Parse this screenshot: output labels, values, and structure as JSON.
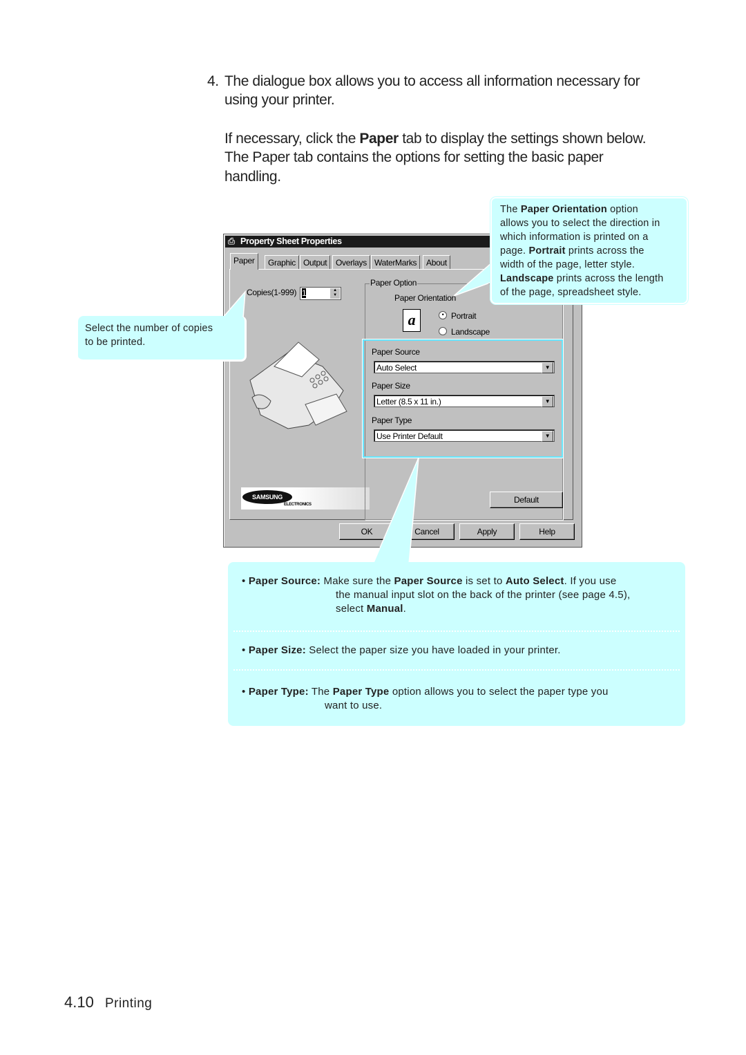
{
  "intro": {
    "step_number": "4.",
    "line1": "The dialogue box allows you to access all information necessary for",
    "line2": "using your printer.",
    "para2_pre": "If necessary, click the ",
    "para2_bold": "Paper",
    "para2_post": " tab to display the settings shown below.",
    "para2_line2": "The Paper tab contains the options for setting the basic paper",
    "para2_line3": "handling."
  },
  "callout_orientation": {
    "t1": "The ",
    "b1": "Paper Orientation",
    "t2": " option",
    "l2": "allows you to select the direction in",
    "l3": "which information is printed on a",
    "t3": "page. ",
    "b2": "Portrait",
    "t4": " prints across the",
    "l5": "width of the page, letter style.",
    "b3": "Landscape",
    "t5": " prints across the length",
    "l7": "of the page, spreadsheet style."
  },
  "callout_copies": {
    "l1": "Select the number of copies",
    "l2": "to be printed."
  },
  "dialog": {
    "title": "Property Sheet Properties",
    "tabs": [
      "Paper",
      "Graphic",
      "Output",
      "Overlays",
      "WaterMarks",
      "About"
    ],
    "copies_label": "Copies(1-999)",
    "copies_value": "1",
    "paper_option_label": "Paper Option",
    "paper_orientation_label": "Paper Orientation",
    "portrait_label": "Portrait",
    "landscape_label": "Landscape",
    "orientation_selected": "Portrait",
    "paper_source_label": "Paper Source",
    "paper_source_value": "Auto Select",
    "paper_size_label": "Paper Size",
    "paper_size_value": "Letter (8.5 x 11 in.)",
    "paper_type_label": "Paper Type",
    "paper_type_value": "Use Printer Default",
    "logo_text": "SAMSUNG",
    "logo_sub": "ELECTRONICS",
    "default_button": "Default",
    "ok_button": "OK",
    "cancel_button": "Cancel",
    "apply_button": "Apply",
    "help_button": "Help"
  },
  "bullets": {
    "source": {
      "b1": "Paper Source:",
      "t1": " Make sure the ",
      "b2": "Paper Source",
      "t2": " is set to ",
      "b3": "Auto Select",
      "t3": ". If you use",
      "l2": "the manual input slot on the back of the printer (see page 4.5),",
      "t4": "select ",
      "b4": "Manual",
      "t5": "."
    },
    "size": {
      "b1": "Paper Size:",
      "t1": " Select the paper size you have loaded in your printer."
    },
    "type": {
      "b1": "Paper Type:",
      "t1": " The ",
      "b2": "Paper Type",
      "t2": " option allows you to select the paper type you",
      "l2": "want to use."
    }
  },
  "footer": {
    "page": "4.10",
    "section": "Printing"
  },
  "colors": {
    "callout": "#ccffff",
    "highlight": "#66e6ff",
    "dialog": "#c0c0c0"
  }
}
